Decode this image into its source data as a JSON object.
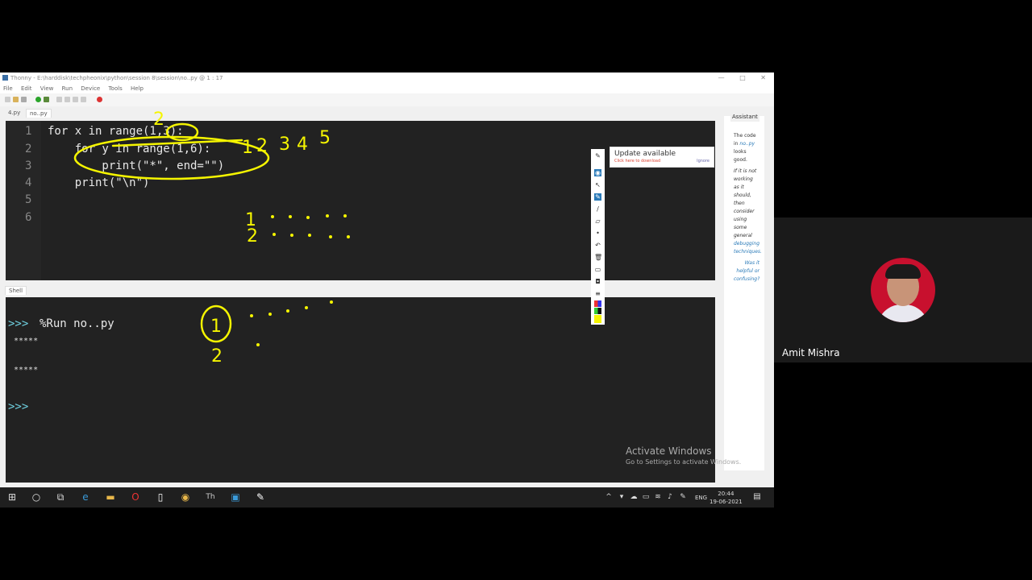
{
  "window": {
    "title": "Thonny  -  E:\\harddisk\\techpheonix\\python\\session 8\\session\\no..py  @  1 : 17",
    "controls": [
      "—",
      "□",
      "✕"
    ]
  },
  "menu": [
    "File",
    "Edit",
    "View",
    "Run",
    "Device",
    "Tools",
    "Help"
  ],
  "tabs": [
    "4.py",
    "no..py"
  ],
  "editor": {
    "line_numbers": [
      "1",
      "2",
      "3",
      "4",
      "5",
      "6"
    ],
    "lines": [
      "for x in range(1,3):",
      "    for y in range(1,6):",
      "        print(\"*\", end=\"\")",
      "    print(\"\\n\")",
      "",
      ""
    ]
  },
  "shell": {
    "tab_label": "Shell",
    "prompt": ">>>",
    "command": "%Run no..py",
    "output": [
      "*****",
      "",
      "*****"
    ],
    "prompt2": ">>>"
  },
  "assistant": {
    "title": "Assistant",
    "msg_prefix": "The code in",
    "msg_link": "no..py",
    "msg_suffix": "looks good.",
    "advice_a": "If it is not working as it should, then consider using some general",
    "advice_link": "debugging techniques.",
    "feedback_link": "Was it helpful or confusing?"
  },
  "update_popup": {
    "title": "Update available",
    "subtitle": "Click here to download",
    "ignore": "Ignore"
  },
  "watermark": {
    "line1": "Activate Windows",
    "line2": "Go to Settings to activate Windows."
  },
  "taskbar": {
    "lang": "ENG",
    "time": "20:44",
    "date": "19-06-2021"
  },
  "participant": {
    "name": "Amit Mishra"
  },
  "annotations": {
    "top_numbers": [
      "1",
      "2",
      "3",
      "4",
      "5"
    ],
    "row_labels": [
      "1",
      "2"
    ],
    "outer_count": "2"
  },
  "colors": {
    "editor_bg": "#222222",
    "ink": "#f5f500",
    "prompt": "#6fd0e0",
    "link": "#2a7ab8",
    "avatar_bg": "#c8102e"
  }
}
